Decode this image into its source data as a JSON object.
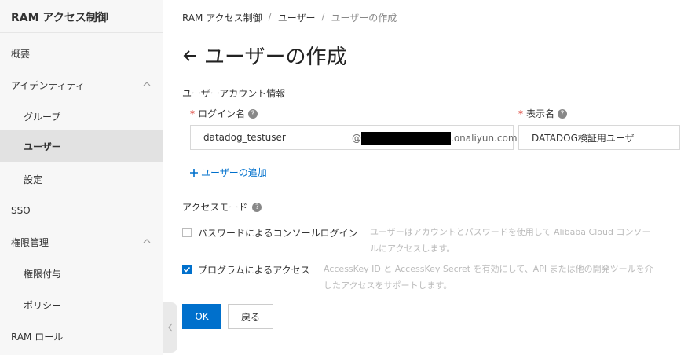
{
  "sidebar": {
    "title": "RAM アクセス制御",
    "items": [
      {
        "label": "概要"
      },
      {
        "label": "アイデンティティ"
      },
      {
        "label": "グループ"
      },
      {
        "label": "ユーザー"
      },
      {
        "label": "設定"
      },
      {
        "label": "SSO"
      },
      {
        "label": "権限管理"
      },
      {
        "label": "権限付与"
      },
      {
        "label": "ポリシー"
      },
      {
        "label": "RAM ロール"
      }
    ]
  },
  "breadcrumb": {
    "items": [
      "RAM アクセス制御",
      "ユーザー",
      "ユーザーの作成"
    ],
    "separator": "/"
  },
  "page": {
    "title": "ユーザーの作成",
    "section_label": "ユーザーアカウント情報"
  },
  "form": {
    "login_name": {
      "label": "ログイン名",
      "required_mark": "*",
      "value": "datadog_testuser",
      "suffix_at": "@",
      "suffix_domain": ".onaliyun.com"
    },
    "display_name": {
      "label": "表示名",
      "required_mark": "*",
      "value": "DATADOG検証用ユーザ"
    },
    "help_glyph": "?",
    "add_user_label": "ユーザーの追加",
    "access_mode": {
      "label": "アクセスモード",
      "options": [
        {
          "label": "パスワードによるコンソールログイン",
          "description": "ユーザーはアカウントとパスワードを使用して Alibaba Cloud コンソールにアクセスします。",
          "checked": false
        },
        {
          "label": "プログラムによるアクセス",
          "description": "AccessKey ID と AccessKey Secret を有効にして、API または他の開発ツールを介したアクセスをサポートします。",
          "checked": true
        }
      ]
    }
  },
  "buttons": {
    "ok_label": "OK",
    "back_label": "戻る"
  },
  "colors": {
    "accent": "#0070cc",
    "required": "#d93026",
    "sidebar_bg": "#f7f7f7",
    "sidebar_active": "#e2e2e2"
  }
}
